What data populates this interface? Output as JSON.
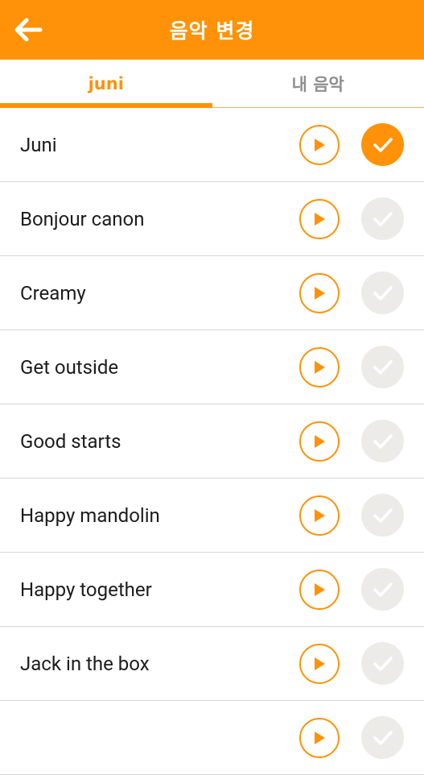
{
  "appbar": {
    "title": "음악 변경",
    "back_icon": "arrow-left-icon"
  },
  "tabs": [
    {
      "label": "juni",
      "active": true
    },
    {
      "label": "내 음악",
      "active": false
    }
  ],
  "tracks": [
    {
      "name": "Juni",
      "selected": true
    },
    {
      "name": "Bonjour canon",
      "selected": false
    },
    {
      "name": "Creamy",
      "selected": false
    },
    {
      "name": "Get outside",
      "selected": false
    },
    {
      "name": "Good starts",
      "selected": false
    },
    {
      "name": "Happy mandolin",
      "selected": false
    },
    {
      "name": "Happy together",
      "selected": false
    },
    {
      "name": "Jack in the box",
      "selected": false
    },
    {
      "name": "",
      "selected": false
    }
  ],
  "icons": {
    "play": "play-icon",
    "check": "check-icon"
  },
  "colors": {
    "accent": "#ff9208",
    "check_off": "#edebe7",
    "divider": "#d6d6d6"
  }
}
